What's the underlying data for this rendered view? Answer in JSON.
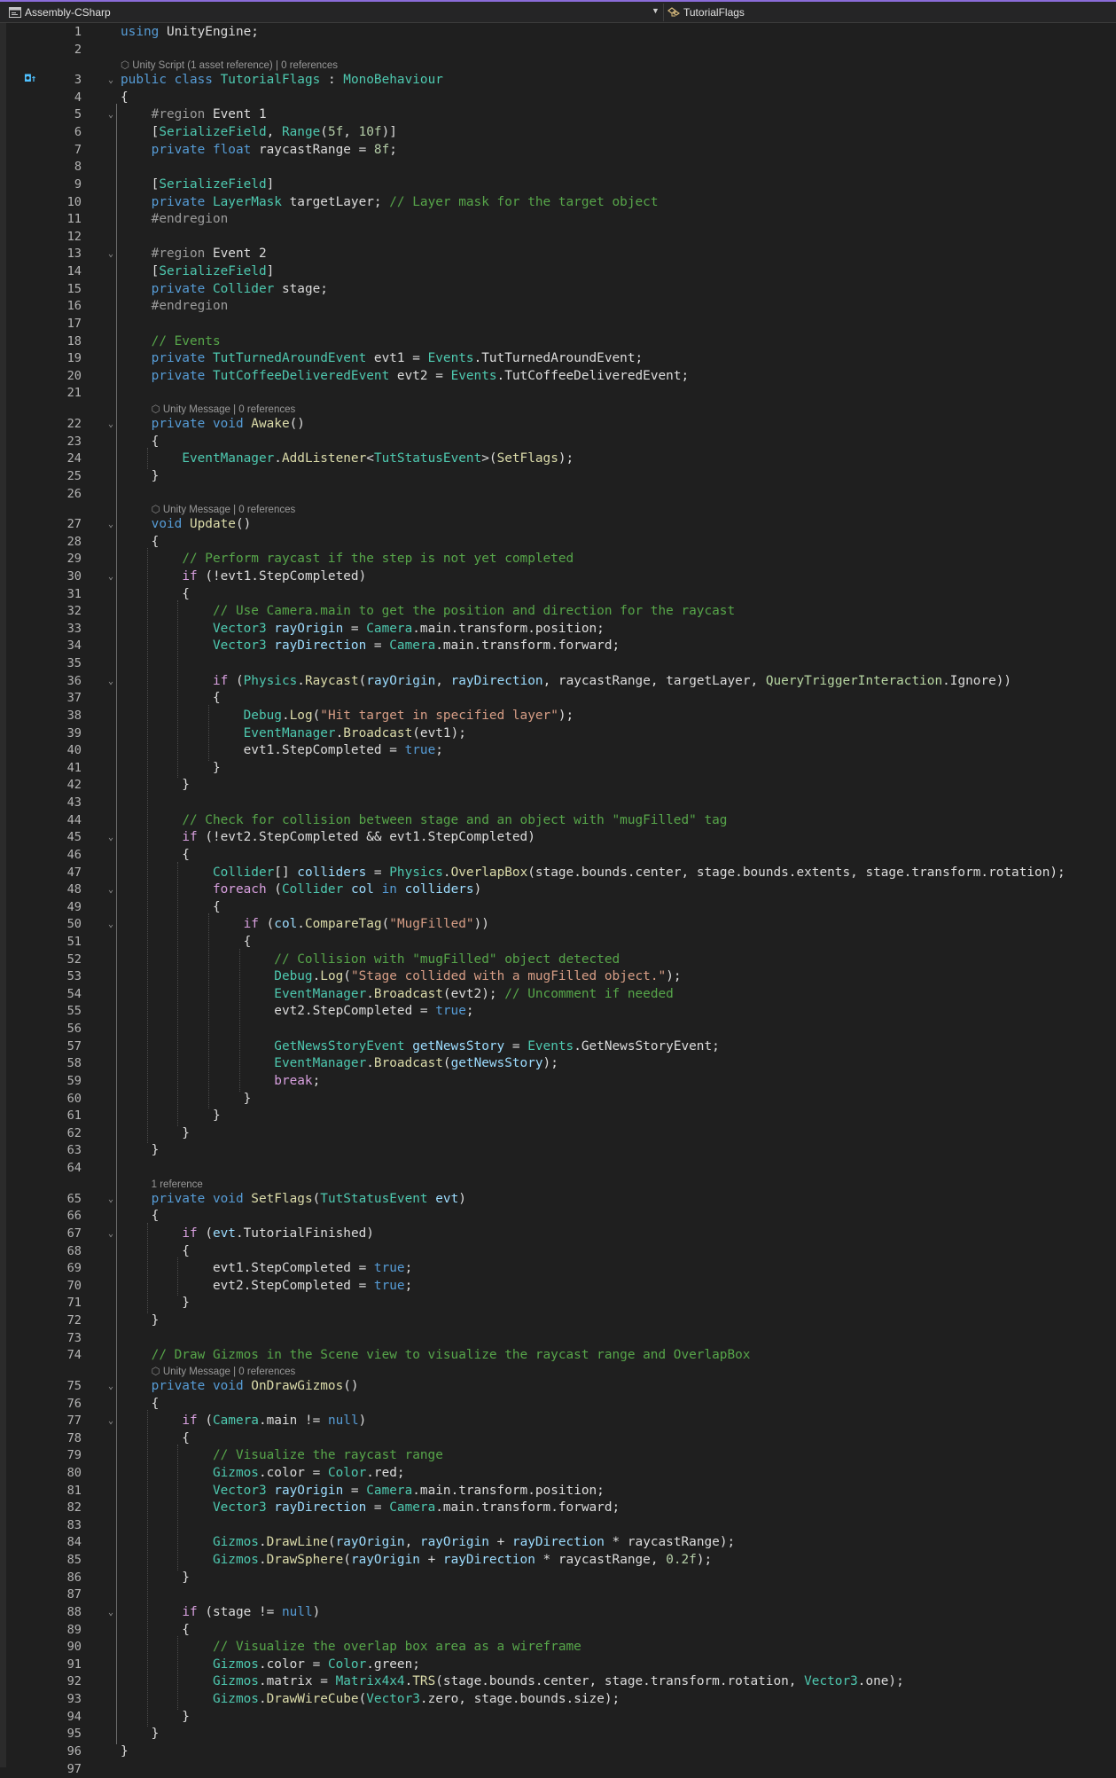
{
  "navbar": {
    "project": "Assembly-CSharp",
    "member": "TutorialFlags"
  },
  "codelens": [
    {
      "line": 3,
      "text": "Unity Script (1 asset reference) | 0 references",
      "icon": "unity-icon"
    },
    {
      "line": 22,
      "text": "Unity Message | 0 references",
      "icon": "unity-icon"
    },
    {
      "line": 27,
      "text": "Unity Message | 0 references",
      "icon": "unity-icon"
    },
    {
      "line": 65,
      "text": "1 reference",
      "icon": ""
    },
    {
      "line": 75,
      "text": "Unity Message | 0 references",
      "icon": "unity-icon"
    }
  ],
  "folds": [
    3,
    5,
    13,
    22,
    27,
    30,
    36,
    45,
    48,
    50,
    65,
    67,
    75,
    77,
    88
  ],
  "lines": [
    [
      [
        "k",
        "using "
      ],
      [
        "p",
        "UnityEngine;"
      ]
    ],
    [],
    [
      [
        "k",
        "public class "
      ],
      [
        "t",
        "TutorialFlags"
      ],
      [
        "p",
        " : "
      ],
      [
        "t",
        "MonoBehaviour"
      ]
    ],
    [
      [
        "p",
        "{"
      ]
    ],
    [
      [
        "p",
        "    "
      ],
      [
        "r",
        "#region "
      ],
      [
        "p",
        "Event 1"
      ]
    ],
    [
      [
        "p",
        "    ["
      ],
      [
        "t",
        "SerializeField"
      ],
      [
        "p",
        ", "
      ],
      [
        "t",
        "Range"
      ],
      [
        "p",
        "("
      ],
      [
        "n",
        "5f"
      ],
      [
        "p",
        ", "
      ],
      [
        "n",
        "10f"
      ],
      [
        "p",
        ")]"
      ]
    ],
    [
      [
        "p",
        "    "
      ],
      [
        "k",
        "private float "
      ],
      [
        "p",
        "raycastRange = "
      ],
      [
        "n",
        "8f"
      ],
      [
        "p",
        ";"
      ]
    ],
    [],
    [
      [
        "p",
        "    ["
      ],
      [
        "t",
        "SerializeField"
      ],
      [
        "p",
        "]"
      ]
    ],
    [
      [
        "p",
        "    "
      ],
      [
        "k",
        "private "
      ],
      [
        "t",
        "LayerMask "
      ],
      [
        "p",
        "targetLayer; "
      ],
      [
        "c",
        "// Layer mask for the target object"
      ]
    ],
    [
      [
        "p",
        "    "
      ],
      [
        "r",
        "#endregion"
      ]
    ],
    [],
    [
      [
        "p",
        "    "
      ],
      [
        "r",
        "#region "
      ],
      [
        "p",
        "Event 2"
      ]
    ],
    [
      [
        "p",
        "    ["
      ],
      [
        "t",
        "SerializeField"
      ],
      [
        "p",
        "]"
      ]
    ],
    [
      [
        "p",
        "    "
      ],
      [
        "k",
        "private "
      ],
      [
        "t",
        "Collider "
      ],
      [
        "p",
        "stage;"
      ]
    ],
    [
      [
        "p",
        "    "
      ],
      [
        "r",
        "#endregion"
      ]
    ],
    [],
    [
      [
        "p",
        "    "
      ],
      [
        "c",
        "// Events"
      ]
    ],
    [
      [
        "p",
        "    "
      ],
      [
        "k",
        "private "
      ],
      [
        "t",
        "TutTurnedAroundEvent "
      ],
      [
        "p",
        "evt1 = "
      ],
      [
        "t",
        "Events"
      ],
      [
        "p",
        ".TutTurnedAroundEvent;"
      ]
    ],
    [
      [
        "p",
        "    "
      ],
      [
        "k",
        "private "
      ],
      [
        "t",
        "TutCoffeeDeliveredEvent "
      ],
      [
        "p",
        "evt2 = "
      ],
      [
        "t",
        "Events"
      ],
      [
        "p",
        ".TutCoffeeDeliveredEvent;"
      ]
    ],
    [],
    [
      [
        "p",
        "    "
      ],
      [
        "k",
        "private void "
      ],
      [
        "m",
        "Awake"
      ],
      [
        "p",
        "()"
      ]
    ],
    [
      [
        "p",
        "    {"
      ]
    ],
    [
      [
        "p",
        "        "
      ],
      [
        "t",
        "EventManager"
      ],
      [
        "p",
        "."
      ],
      [
        "m",
        "AddListener"
      ],
      [
        "p",
        "<"
      ],
      [
        "t",
        "TutStatusEvent"
      ],
      [
        "p",
        ">("
      ],
      [
        "m",
        "SetFlags"
      ],
      [
        "p",
        ");"
      ]
    ],
    [
      [
        "p",
        "    }"
      ]
    ],
    [],
    [
      [
        "p",
        "    "
      ],
      [
        "k",
        "void "
      ],
      [
        "m",
        "Update"
      ],
      [
        "p",
        "()"
      ]
    ],
    [
      [
        "p",
        "    {"
      ]
    ],
    [
      [
        "p",
        "        "
      ],
      [
        "c",
        "// Perform raycast if the step is not yet completed"
      ]
    ],
    [
      [
        "p",
        "        "
      ],
      [
        "ctl",
        "if "
      ],
      [
        "p",
        "(!evt1.StepCompleted)"
      ]
    ],
    [
      [
        "p",
        "        {"
      ]
    ],
    [
      [
        "p",
        "            "
      ],
      [
        "c",
        "// Use Camera.main to get the position and direction for the raycast"
      ]
    ],
    [
      [
        "p",
        "            "
      ],
      [
        "t",
        "Vector3 "
      ],
      [
        "v",
        "rayOrigin"
      ],
      [
        "p",
        " = "
      ],
      [
        "t",
        "Camera"
      ],
      [
        "p",
        ".main.transform.position;"
      ]
    ],
    [
      [
        "p",
        "            "
      ],
      [
        "t",
        "Vector3 "
      ],
      [
        "v",
        "rayDirection"
      ],
      [
        "p",
        " = "
      ],
      [
        "t",
        "Camera"
      ],
      [
        "p",
        ".main.transform.forward;"
      ]
    ],
    [],
    [
      [
        "p",
        "            "
      ],
      [
        "ctl",
        "if "
      ],
      [
        "p",
        "("
      ],
      [
        "t",
        "Physics"
      ],
      [
        "p",
        "."
      ],
      [
        "m",
        "Raycast"
      ],
      [
        "p",
        "("
      ],
      [
        "v",
        "rayOrigin"
      ],
      [
        "p",
        ", "
      ],
      [
        "v",
        "rayDirection"
      ],
      [
        "p",
        ", raycastRange, targetLayer, "
      ],
      [
        "e",
        "QueryTriggerInteraction"
      ],
      [
        "p",
        ".Ignore))"
      ]
    ],
    [
      [
        "p",
        "            {"
      ]
    ],
    [
      [
        "p",
        "                "
      ],
      [
        "t",
        "Debug"
      ],
      [
        "p",
        "."
      ],
      [
        "m",
        "Log"
      ],
      [
        "p",
        "("
      ],
      [
        "s",
        "\"Hit target in specified layer\""
      ],
      [
        "p",
        ");"
      ]
    ],
    [
      [
        "p",
        "                "
      ],
      [
        "t",
        "EventManager"
      ],
      [
        "p",
        "."
      ],
      [
        "m",
        "Broadcast"
      ],
      [
        "p",
        "(evt1);"
      ]
    ],
    [
      [
        "p",
        "                evt1.StepCompleted = "
      ],
      [
        "k",
        "true"
      ],
      [
        "p",
        ";"
      ]
    ],
    [
      [
        "p",
        "            }"
      ]
    ],
    [
      [
        "p",
        "        }"
      ]
    ],
    [],
    [
      [
        "p",
        "        "
      ],
      [
        "c",
        "// Check for collision between stage and an object with \"mugFilled\" tag"
      ]
    ],
    [
      [
        "p",
        "        "
      ],
      [
        "ctl",
        "if "
      ],
      [
        "p",
        "(!evt2.StepCompleted && evt1.StepCompleted)"
      ]
    ],
    [
      [
        "p",
        "        {"
      ]
    ],
    [
      [
        "p",
        "            "
      ],
      [
        "t",
        "Collider"
      ],
      [
        "p",
        "[] "
      ],
      [
        "v",
        "colliders"
      ],
      [
        "p",
        " = "
      ],
      [
        "t",
        "Physics"
      ],
      [
        "p",
        "."
      ],
      [
        "m",
        "OverlapBox"
      ],
      [
        "p",
        "(stage.bounds.center, stage.bounds.extents, stage.transform.rotation);"
      ]
    ],
    [
      [
        "p",
        "            "
      ],
      [
        "ctl",
        "foreach "
      ],
      [
        "p",
        "("
      ],
      [
        "t",
        "Collider "
      ],
      [
        "v",
        "col"
      ],
      [
        "k",
        " in "
      ],
      [
        "v",
        "colliders"
      ],
      [
        "p",
        ")"
      ]
    ],
    [
      [
        "p",
        "            {"
      ]
    ],
    [
      [
        "p",
        "                "
      ],
      [
        "ctl",
        "if "
      ],
      [
        "p",
        "("
      ],
      [
        "v",
        "col"
      ],
      [
        "p",
        "."
      ],
      [
        "m",
        "CompareTag"
      ],
      [
        "p",
        "("
      ],
      [
        "s",
        "\"MugFilled\""
      ],
      [
        "p",
        "))"
      ]
    ],
    [
      [
        "p",
        "                {"
      ]
    ],
    [
      [
        "p",
        "                    "
      ],
      [
        "c",
        "// Collision with \"mugFilled\" object detected"
      ]
    ],
    [
      [
        "p",
        "                    "
      ],
      [
        "t",
        "Debug"
      ],
      [
        "p",
        "."
      ],
      [
        "m",
        "Log"
      ],
      [
        "p",
        "("
      ],
      [
        "s",
        "\"Stage collided with a mugFilled object.\""
      ],
      [
        "p",
        ");"
      ]
    ],
    [
      [
        "p",
        "                    "
      ],
      [
        "t",
        "EventManager"
      ],
      [
        "p",
        "."
      ],
      [
        "m",
        "Broadcast"
      ],
      [
        "p",
        "(evt2); "
      ],
      [
        "c",
        "// Uncomment if needed"
      ]
    ],
    [
      [
        "p",
        "                    evt2.StepCompleted = "
      ],
      [
        "k",
        "true"
      ],
      [
        "p",
        ";"
      ]
    ],
    [],
    [
      [
        "p",
        "                    "
      ],
      [
        "t",
        "GetNewsStoryEvent "
      ],
      [
        "v",
        "getNewsStory"
      ],
      [
        "p",
        " = "
      ],
      [
        "t",
        "Events"
      ],
      [
        "p",
        ".GetNewsStoryEvent;"
      ]
    ],
    [
      [
        "p",
        "                    "
      ],
      [
        "t",
        "EventManager"
      ],
      [
        "p",
        "."
      ],
      [
        "m",
        "Broadcast"
      ],
      [
        "p",
        "("
      ],
      [
        "v",
        "getNewsStory"
      ],
      [
        "p",
        ");"
      ]
    ],
    [
      [
        "p",
        "                    "
      ],
      [
        "ctl",
        "break"
      ],
      [
        "p",
        ";"
      ]
    ],
    [
      [
        "p",
        "                }"
      ]
    ],
    [
      [
        "p",
        "            }"
      ]
    ],
    [
      [
        "p",
        "        }"
      ]
    ],
    [
      [
        "p",
        "    }"
      ]
    ],
    [],
    [
      [
        "p",
        "    "
      ],
      [
        "k",
        "private void "
      ],
      [
        "m",
        "SetFlags"
      ],
      [
        "p",
        "("
      ],
      [
        "t",
        "TutStatusEvent "
      ],
      [
        "v",
        "evt"
      ],
      [
        "p",
        ")"
      ]
    ],
    [
      [
        "p",
        "    {"
      ]
    ],
    [
      [
        "p",
        "        "
      ],
      [
        "ctl",
        "if "
      ],
      [
        "p",
        "("
      ],
      [
        "v",
        "evt"
      ],
      [
        "p",
        ".TutorialFinished)"
      ]
    ],
    [
      [
        "p",
        "        {"
      ]
    ],
    [
      [
        "p",
        "            evt1.StepCompleted = "
      ],
      [
        "k",
        "true"
      ],
      [
        "p",
        ";"
      ]
    ],
    [
      [
        "p",
        "            evt2.StepCompleted = "
      ],
      [
        "k",
        "true"
      ],
      [
        "p",
        ";"
      ]
    ],
    [
      [
        "p",
        "        }"
      ]
    ],
    [
      [
        "p",
        "    }"
      ]
    ],
    [],
    [
      [
        "p",
        "    "
      ],
      [
        "c",
        "// Draw Gizmos in the Scene view to visualize the raycast range and OverlapBox"
      ]
    ],
    [
      [
        "p",
        "    "
      ],
      [
        "k",
        "private void "
      ],
      [
        "m",
        "OnDrawGizmos"
      ],
      [
        "p",
        "()"
      ]
    ],
    [
      [
        "p",
        "    {"
      ]
    ],
    [
      [
        "p",
        "        "
      ],
      [
        "ctl",
        "if "
      ],
      [
        "p",
        "("
      ],
      [
        "t",
        "Camera"
      ],
      [
        "p",
        ".main != "
      ],
      [
        "k",
        "null"
      ],
      [
        "p",
        ")"
      ]
    ],
    [
      [
        "p",
        "        {"
      ]
    ],
    [
      [
        "p",
        "            "
      ],
      [
        "c",
        "// Visualize the raycast range"
      ]
    ],
    [
      [
        "p",
        "            "
      ],
      [
        "t",
        "Gizmos"
      ],
      [
        "p",
        ".color = "
      ],
      [
        "t",
        "Color"
      ],
      [
        "p",
        ".red;"
      ]
    ],
    [
      [
        "p",
        "            "
      ],
      [
        "t",
        "Vector3 "
      ],
      [
        "v",
        "rayOrigin"
      ],
      [
        "p",
        " = "
      ],
      [
        "t",
        "Camera"
      ],
      [
        "p",
        ".main.transform.position;"
      ]
    ],
    [
      [
        "p",
        "            "
      ],
      [
        "t",
        "Vector3 "
      ],
      [
        "v",
        "rayDirection"
      ],
      [
        "p",
        " = "
      ],
      [
        "t",
        "Camera"
      ],
      [
        "p",
        ".main.transform.forward;"
      ]
    ],
    [],
    [
      [
        "p",
        "            "
      ],
      [
        "t",
        "Gizmos"
      ],
      [
        "p",
        "."
      ],
      [
        "m",
        "DrawLine"
      ],
      [
        "p",
        "("
      ],
      [
        "v",
        "rayOrigin"
      ],
      [
        "p",
        ", "
      ],
      [
        "v",
        "rayOrigin"
      ],
      [
        "p",
        " + "
      ],
      [
        "v",
        "rayDirection"
      ],
      [
        "p",
        " * raycastRange);"
      ]
    ],
    [
      [
        "p",
        "            "
      ],
      [
        "t",
        "Gizmos"
      ],
      [
        "p",
        "."
      ],
      [
        "m",
        "DrawSphere"
      ],
      [
        "p",
        "("
      ],
      [
        "v",
        "rayOrigin"
      ],
      [
        "p",
        " + "
      ],
      [
        "v",
        "rayDirection"
      ],
      [
        "p",
        " * raycastRange, "
      ],
      [
        "n",
        "0.2f"
      ],
      [
        "p",
        ");"
      ]
    ],
    [
      [
        "p",
        "        }"
      ]
    ],
    [],
    [
      [
        "p",
        "        "
      ],
      [
        "ctl",
        "if "
      ],
      [
        "p",
        "(stage != "
      ],
      [
        "k",
        "null"
      ],
      [
        "p",
        ")"
      ]
    ],
    [
      [
        "p",
        "        {"
      ]
    ],
    [
      [
        "p",
        "            "
      ],
      [
        "c",
        "// Visualize the overlap box area as a wireframe"
      ]
    ],
    [
      [
        "p",
        "            "
      ],
      [
        "t",
        "Gizmos"
      ],
      [
        "p",
        ".color = "
      ],
      [
        "t",
        "Color"
      ],
      [
        "p",
        ".green;"
      ]
    ],
    [
      [
        "p",
        "            "
      ],
      [
        "t",
        "Gizmos"
      ],
      [
        "p",
        ".matrix = "
      ],
      [
        "t",
        "Matrix4x4"
      ],
      [
        "p",
        "."
      ],
      [
        "m",
        "TRS"
      ],
      [
        "p",
        "(stage.bounds.center, stage.transform.rotation, "
      ],
      [
        "t",
        "Vector3"
      ],
      [
        "p",
        ".one);"
      ]
    ],
    [
      [
        "p",
        "            "
      ],
      [
        "t",
        "Gizmos"
      ],
      [
        "p",
        "."
      ],
      [
        "m",
        "DrawWireCube"
      ],
      [
        "p",
        "("
      ],
      [
        "t",
        "Vector3"
      ],
      [
        "p",
        ".zero, stage.bounds.size);"
      ]
    ],
    [
      [
        "p",
        "        }"
      ]
    ],
    [
      [
        "p",
        "    }"
      ]
    ],
    [
      [
        "p",
        "}"
      ]
    ],
    []
  ]
}
